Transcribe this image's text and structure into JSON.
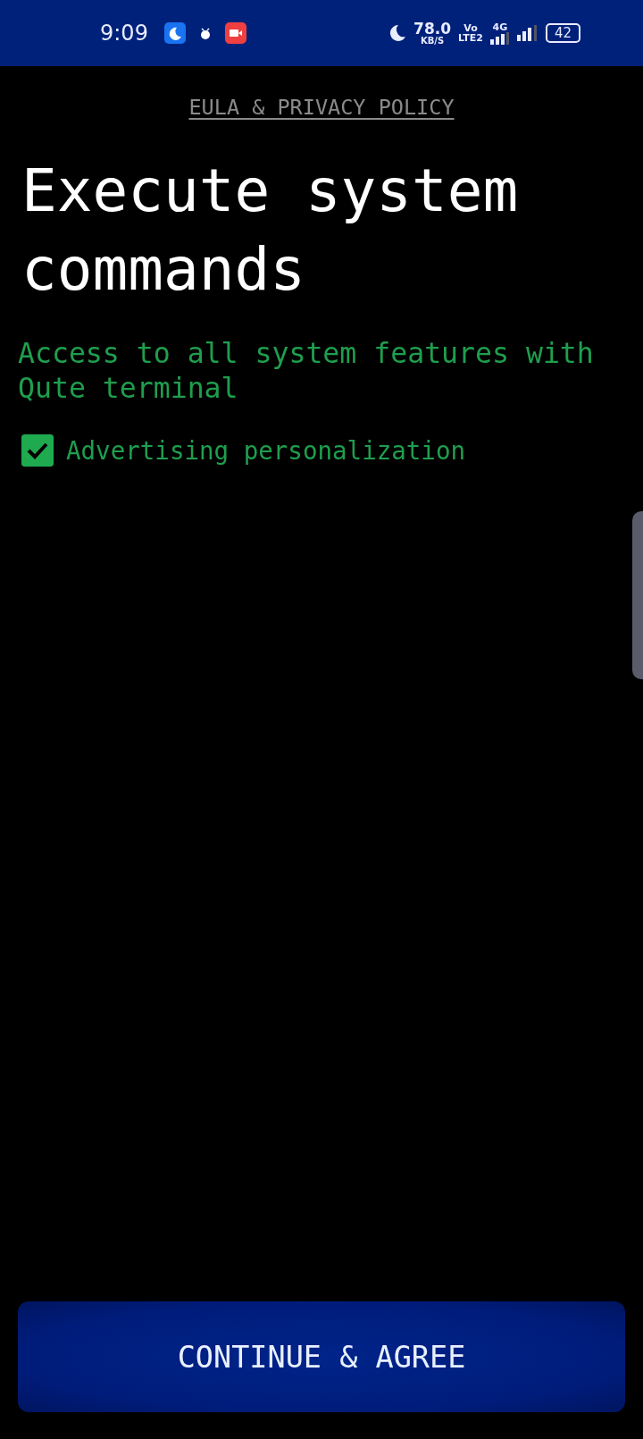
{
  "status_bar": {
    "time": "9:09",
    "net_speed": "78.0",
    "net_unit": "KB/S",
    "volte_top": "Vo",
    "volte_bottom": "LTE2",
    "network": "4G",
    "battery": "42"
  },
  "eula_link": "EULA & PRIVACY POLICY",
  "title": "Execute system commands",
  "subtitle": "Access to all system features with Qute terminal",
  "options": [
    {
      "label": "Advertising personalization",
      "checked": true
    }
  ],
  "button": "CONTINUE & AGREE"
}
